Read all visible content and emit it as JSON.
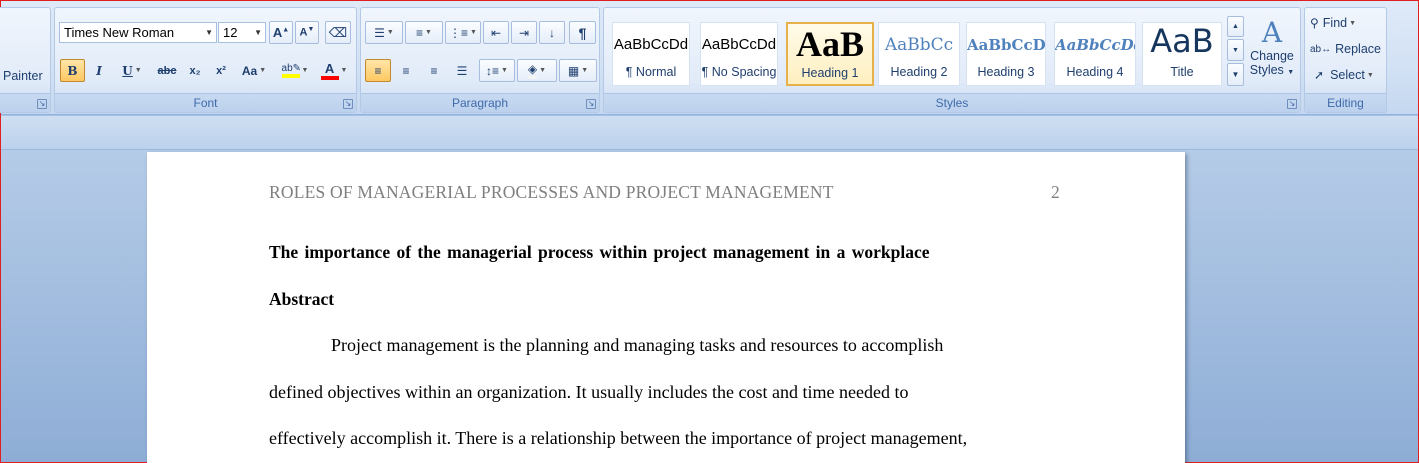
{
  "clipboard": {
    "painter_label": "Painter"
  },
  "font": {
    "group_label": "Font",
    "font_name": "Times New Roman",
    "font_size": "12",
    "bold": "B",
    "italic": "I",
    "underline": "U",
    "strikethrough": "abc",
    "subscript": "x₂",
    "superscript": "x²",
    "change_case": "Aa",
    "grow": "A",
    "shrink": "A",
    "font_color_letter": "A",
    "highlight_color": "#ffff00",
    "font_color": "#ff0000"
  },
  "paragraph": {
    "group_label": "Paragraph",
    "pilcrow": "¶"
  },
  "styles": {
    "group_label": "Styles",
    "items": [
      {
        "sample": "AaBbCcDd",
        "name": "¶ Normal"
      },
      {
        "sample": "AaBbCcDd",
        "name": "¶ No Spacing"
      },
      {
        "sample": "AaB",
        "name": "Heading 1"
      },
      {
        "sample": "AaBbCc",
        "name": "Heading 2"
      },
      {
        "sample": "AaBbCcD",
        "name": "Heading 3"
      },
      {
        "sample": "AaBbCcDd",
        "name": "Heading 4"
      },
      {
        "sample": "AaB",
        "name": "Title"
      }
    ],
    "change_styles_line1": "Change",
    "change_styles_line2": "Styles"
  },
  "editing": {
    "group_label": "Editing",
    "find": "Find",
    "replace": "Replace",
    "select": "Select"
  },
  "document": {
    "header_title": "ROLES OF MANAGERIAL PROCESSES AND PROJECT MANAGEMENT",
    "page_number": "2",
    "heading": "The importance  of the managerial  process  within  project management  in  a workplace",
    "abstract": "Abstract",
    "lines": [
      "Project management is the planning and managing tasks and resources to accomplish",
      "defined objectives within an organization. It usually includes the cost and time needed to",
      "effectively accomplish it. There is a relationship between the importance of project management,"
    ]
  }
}
